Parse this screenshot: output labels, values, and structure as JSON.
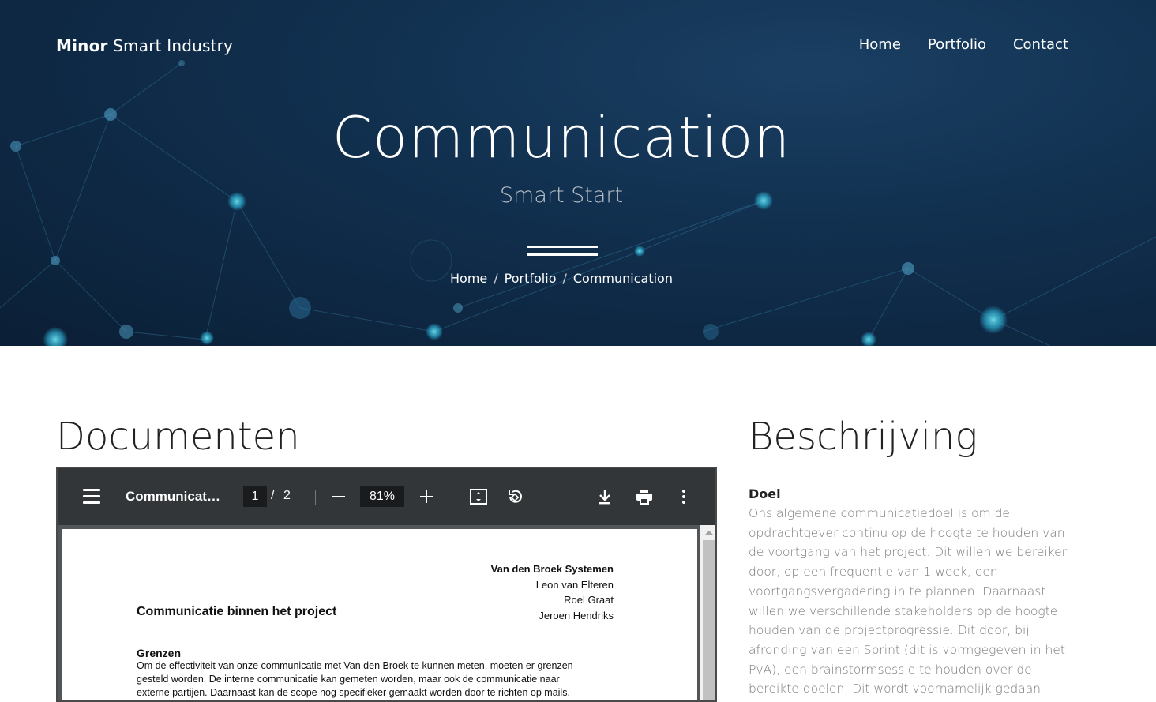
{
  "header": {
    "brand_bold": "Minor",
    "brand_rest": " Smart Industry",
    "nav": [
      "Home",
      "Portfolio",
      "Contact"
    ]
  },
  "hero": {
    "title": "Communication",
    "subtitle": "Smart Start",
    "breadcrumb": [
      "Home",
      "Portfolio",
      "Communication"
    ],
    "breadcrumb_sep": "/"
  },
  "documents": {
    "heading": "Documenten",
    "viewer": {
      "file_title": "Communicati...",
      "current_page": "1",
      "page_sep": "/",
      "total_pages": "2",
      "zoom": "81%",
      "icons": [
        "menu-icon",
        "zoom-out-icon",
        "zoom-in-icon",
        "fit-page-icon",
        "rotate-icon",
        "download-icon",
        "print-icon",
        "more-options-icon"
      ]
    },
    "pdf": {
      "company": "Van den Broek Systemen",
      "people": [
        "Leon van Elteren",
        "Roel Graat",
        "Jeroen Hendriks"
      ],
      "title": "Communicatie binnen het project",
      "section": "Grenzen",
      "lines": [
        "Om de effectiviteit van onze communicatie met Van den Broek te kunnen meten, moeten er grenzen",
        "gesteld worden. De interne communicatie kan gemeten worden, maar ook de communicatie naar",
        "externe partijen. Daarnaast kan de scope nog specifieker gemaakt worden door te richten op mails."
      ]
    }
  },
  "description": {
    "heading": "Beschrijving",
    "subheading": "Doel",
    "text": "Ons algemene communicatiedoel is om de opdrachtgever continu op de hoogte te houden van de voortgang van het project. Dit willen we bereiken door, op een frequentie van 1 week, een voortgangsvergadering in te plannen. Daarnaast willen we verschillende stakeholders op de hoogte houden van de projectprogressie. Dit door, bij afronding van een Sprint (dit is vormgegeven in het PvA), een brainstormsessie te houden over de bereikte doelen. Dit wordt voornamelijk gedaan"
  },
  "colors": {
    "hero_dark": "#0b1f36",
    "hero_mid": "#1a3f63",
    "node_cyan": "#3fb6d6",
    "toolbar": "#323639",
    "viewer_bg": "#525659",
    "muted_text": "#7a7a7a"
  }
}
